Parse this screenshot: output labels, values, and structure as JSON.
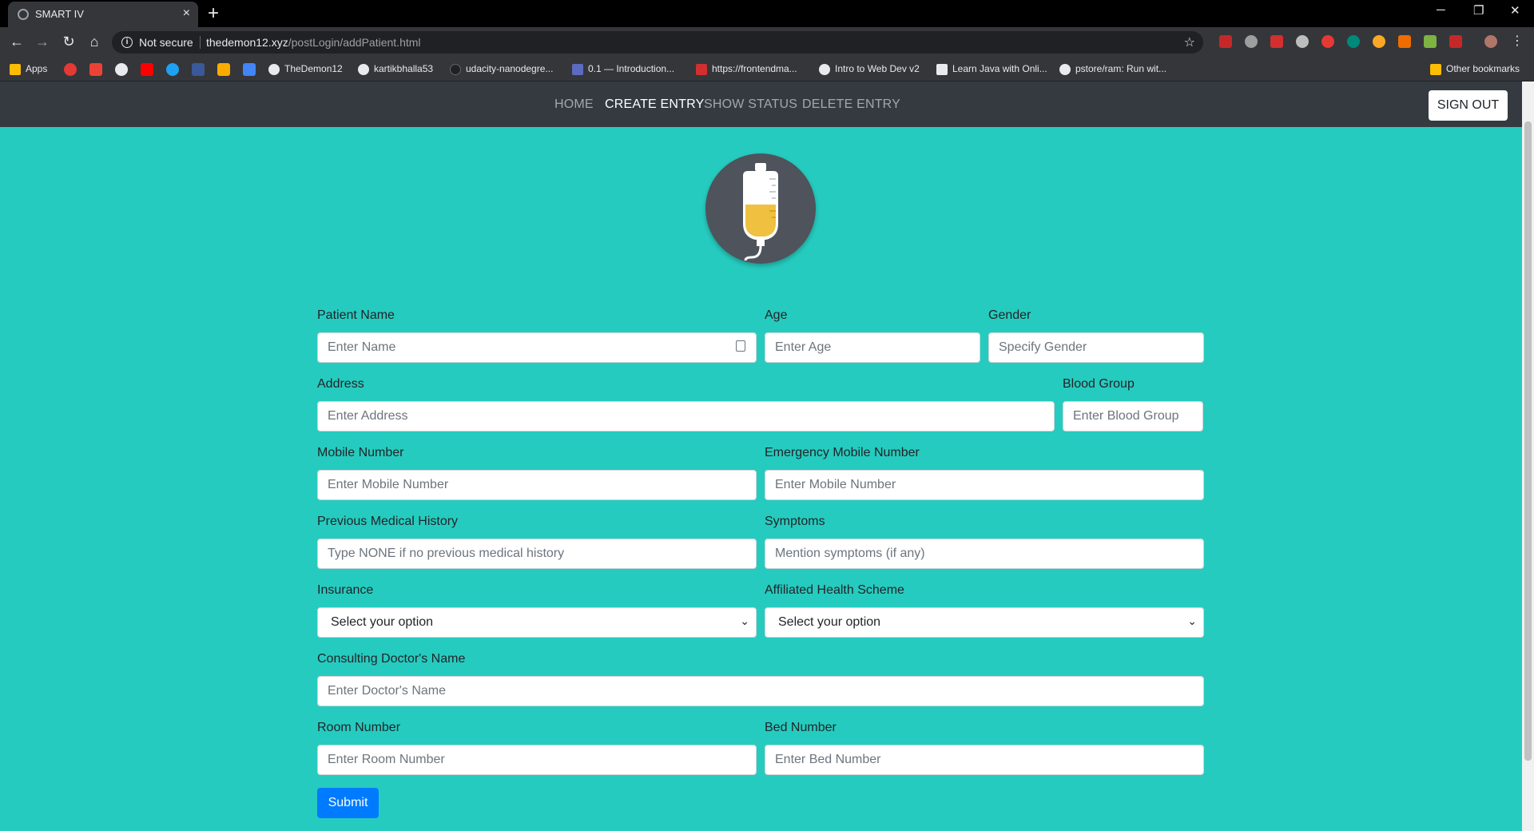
{
  "browser": {
    "tab_title": "SMART IV",
    "tab_close": "×",
    "new_tab": "+",
    "win_minimize": "─",
    "win_restore": "❐",
    "win_close": "✕",
    "back": "←",
    "forward": "→",
    "reload": "↻",
    "home": "⌂",
    "security_text": "Not secure",
    "url_host": "thedemon12.xyz",
    "url_path": "/postLogin/addPatient.html",
    "star": "☆",
    "menu": "⋮"
  },
  "bookmarks": {
    "apps": "Apps",
    "items": [
      "TheDemon12",
      "kartikbhalla53",
      "udacity-nanodegre...",
      "0.1 — Introduction...",
      "https://frontendma...",
      "Intro to Web Dev v2",
      "Learn Java with Onli...",
      "pstore/ram: Run wit..."
    ],
    "other": "Other bookmarks"
  },
  "nav": {
    "links": [
      "HOME",
      "CREATE ENTRY",
      "SHOW STATUS",
      "DELETE ENTRY"
    ],
    "active": "CREATE ENTRY",
    "sign_out": "SIGN OUT"
  },
  "form": {
    "patient_name": {
      "label": "Patient Name",
      "placeholder": "Enter Name"
    },
    "age": {
      "label": "Age",
      "placeholder": "Enter Age"
    },
    "gender": {
      "label": "Gender",
      "placeholder": "Specify Gender"
    },
    "address": {
      "label": "Address",
      "placeholder": "Enter Address"
    },
    "blood_group": {
      "label": "Blood Group",
      "placeholder": "Enter Blood Group"
    },
    "mobile": {
      "label": "Mobile Number",
      "placeholder": "Enter Mobile Number"
    },
    "emergency_mobile": {
      "label": "Emergency Mobile Number",
      "placeholder": "Enter Mobile Number"
    },
    "medical_history": {
      "label": "Previous Medical History",
      "placeholder": "Type NONE if no previous medical history"
    },
    "symptoms": {
      "label": "Symptoms",
      "placeholder": "Mention symptoms (if any)"
    },
    "insurance": {
      "label": "Insurance",
      "selected": "Select your option"
    },
    "health_scheme": {
      "label": "Affiliated Health Scheme",
      "selected": "Select your option"
    },
    "doctor": {
      "label": "Consulting Doctor's Name",
      "placeholder": "Enter Doctor's Name"
    },
    "room": {
      "label": "Room Number",
      "placeholder": "Enter Room Number"
    },
    "bed": {
      "label": "Bed Number",
      "placeholder": "Enter Bed Number"
    },
    "submit": "Submit"
  },
  "colors": {
    "page_bg": "#26cbbf",
    "navbar": "#343a40",
    "submit": "#007bff",
    "logo_bg": "#4e535c",
    "iv_fluid": "#f0c040"
  }
}
